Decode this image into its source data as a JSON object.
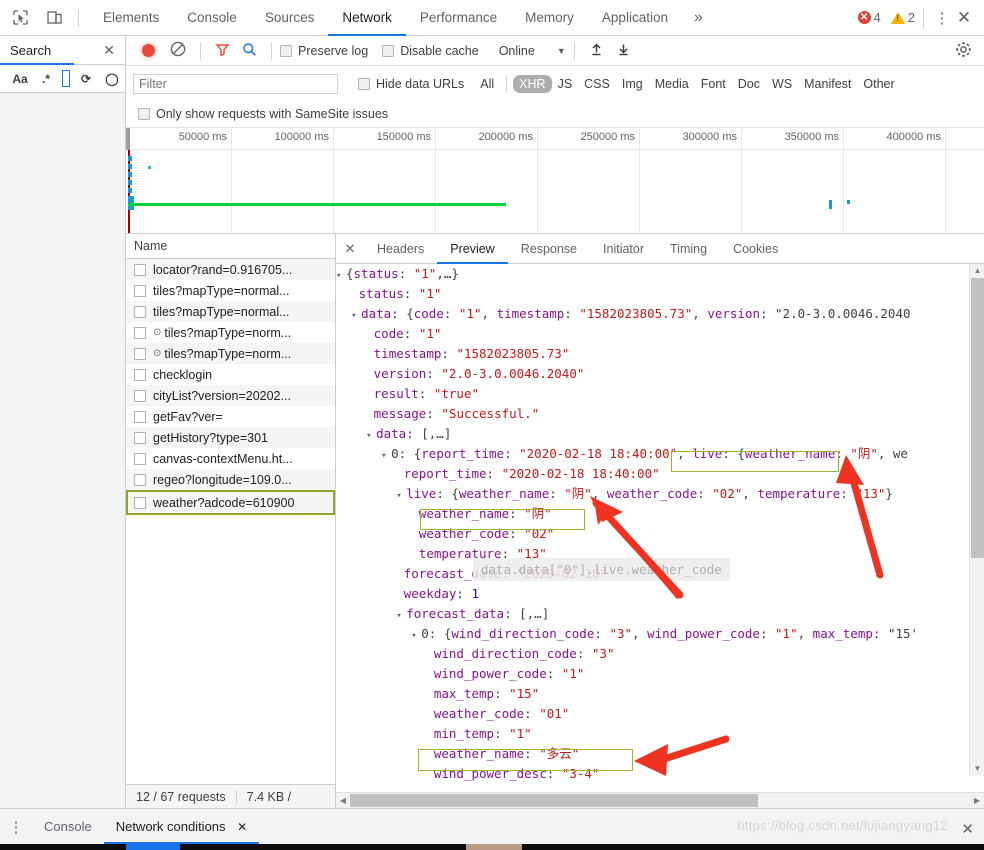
{
  "topbar": {
    "icons": [
      "inspect-icon",
      "device-toolbar-icon"
    ],
    "tabs": [
      "Elements",
      "Console",
      "Sources",
      "Network",
      "Performance",
      "Memory",
      "Application"
    ],
    "active_tab": "Network",
    "more_glyph": "»",
    "error_count": "4",
    "warning_count": "2",
    "kebab_glyph": "⋮",
    "close_glyph": "✕"
  },
  "search_panel": {
    "title": "Search",
    "close_glyph": "✕",
    "tools": {
      "match_case": "Aa",
      "regex": ".*",
      "refresh_glyph": "⟳",
      "clear_glyph": "◯"
    }
  },
  "network_toolbar": {
    "record_label": "record-button",
    "clear_label": "clear-button",
    "filter_icon_label": "filter-funnel-icon",
    "search_icon_label": "search-icon",
    "preserve_log": "Preserve log",
    "disable_cache": "Disable cache",
    "throttling": "Online",
    "caret_glyph": "▼",
    "import_glyph": "⬆",
    "export_glyph": "⬇",
    "settings_label": "settings-gear"
  },
  "filter_row": {
    "placeholder": "Filter",
    "value": "",
    "hide_data_urls": "Hide data URLs",
    "types": [
      "All",
      "XHR",
      "JS",
      "CSS",
      "Img",
      "Media",
      "Font",
      "Doc",
      "WS",
      "Manifest",
      "Other"
    ],
    "active_type": "XHR",
    "samesite": "Only show requests with SameSite issues"
  },
  "overview": {
    "ticks": [
      "50000 ms",
      "100000 ms",
      "150000 ms",
      "200000 ms",
      "250000 ms",
      "300000 ms",
      "350000 ms",
      "400000 ms"
    ]
  },
  "requests": {
    "column_header": "Name",
    "rows": [
      {
        "name": "locator?rand=0.916705...",
        "icon": ""
      },
      {
        "name": "tiles?mapType=normal...",
        "icon": ""
      },
      {
        "name": "tiles?mapType=normal...",
        "icon": ""
      },
      {
        "name": "tiles?mapType=norm...",
        "icon": "⊙"
      },
      {
        "name": "tiles?mapType=norm...",
        "icon": "⊙"
      },
      {
        "name": "checklogin",
        "icon": ""
      },
      {
        "name": "cityList?version=20202...",
        "icon": ""
      },
      {
        "name": "getFav?ver=",
        "icon": ""
      },
      {
        "name": "getHistory?type=301",
        "icon": ""
      },
      {
        "name": "canvas-contextMenu.ht...",
        "icon": ""
      },
      {
        "name": "regeo?longitude=109.0...",
        "icon": ""
      },
      {
        "name": "weather?adcode=610900",
        "icon": "",
        "selected": true
      }
    ]
  },
  "detail_tabs": {
    "close_glyph": "✕",
    "tabs": [
      "Headers",
      "Preview",
      "Response",
      "Initiator",
      "Timing",
      "Cookies"
    ],
    "active": "Preview"
  },
  "json_preview": {
    "lines": [
      "▼{status: \"1\",…}",
      "   status: \"1\"",
      "  ▼data: {code: \"1\", timestamp: \"1582023805.73\", version: \"2.0-3.0.0046.2040",
      "     code: \"1\"",
      "     timestamp: \"1582023805.73\"",
      "     version: \"2.0-3.0.0046.2040\"",
      "     result: \"true\"",
      "     message: \"Successful.\"",
      "    ▼data: [,…]",
      "      ▼0: {report_time: \"2020-02-18 18:40:00\", live: {weather_name: \"阴\", we",
      "         report_time: \"2020-02-18 18:40:00\"",
      "        ▼live: {weather_name: \"阴\", weather_code: \"02\", temperature: \"13\"}",
      "           weather_name: \"阴\"",
      "           weather_code: \"02\"",
      "           temperature: \"13\"",
      "         forecast_date: \"2020-02-18\"",
      "         weekday: 1",
      "        ▼forecast_data: [,…]",
      "          ▼0: {wind_direction_code: \"3\", wind_power_code: \"1\", max_temp: \"15'",
      "             wind_direction_code: \"3\"",
      "             wind_power_code: \"1\"",
      "             max_temp: \"15\"",
      "             weather_code: \"01\"",
      "             min_temp: \"1\"",
      "             weather_name: \"多云\"",
      "             wind_power_desc: \"3-4\""
    ],
    "tooltip": "data.data[\"0\"].live.weather_code"
  },
  "status_bar": {
    "requests": "12 / 67 requests",
    "transferred": "7.4 KB / "
  },
  "drawer": {
    "kebab_glyph": "⋮",
    "tabs": [
      "Console",
      "Network conditions"
    ],
    "active": "Network conditions",
    "tab_close_glyph": "✕",
    "close_glyph": "✕"
  },
  "watermark": "https://blog.csdn.net/lujiangyang12",
  "colors": {
    "accent_blue": "#1a73e8",
    "record_red": "#e8483c",
    "highlight_green": "#9ab52a",
    "arrow_red": "#ee3322",
    "timeline_green": "#00d23c",
    "json_key": "#881391",
    "json_string": "#c41a16",
    "json_number": "#1c00cf"
  }
}
